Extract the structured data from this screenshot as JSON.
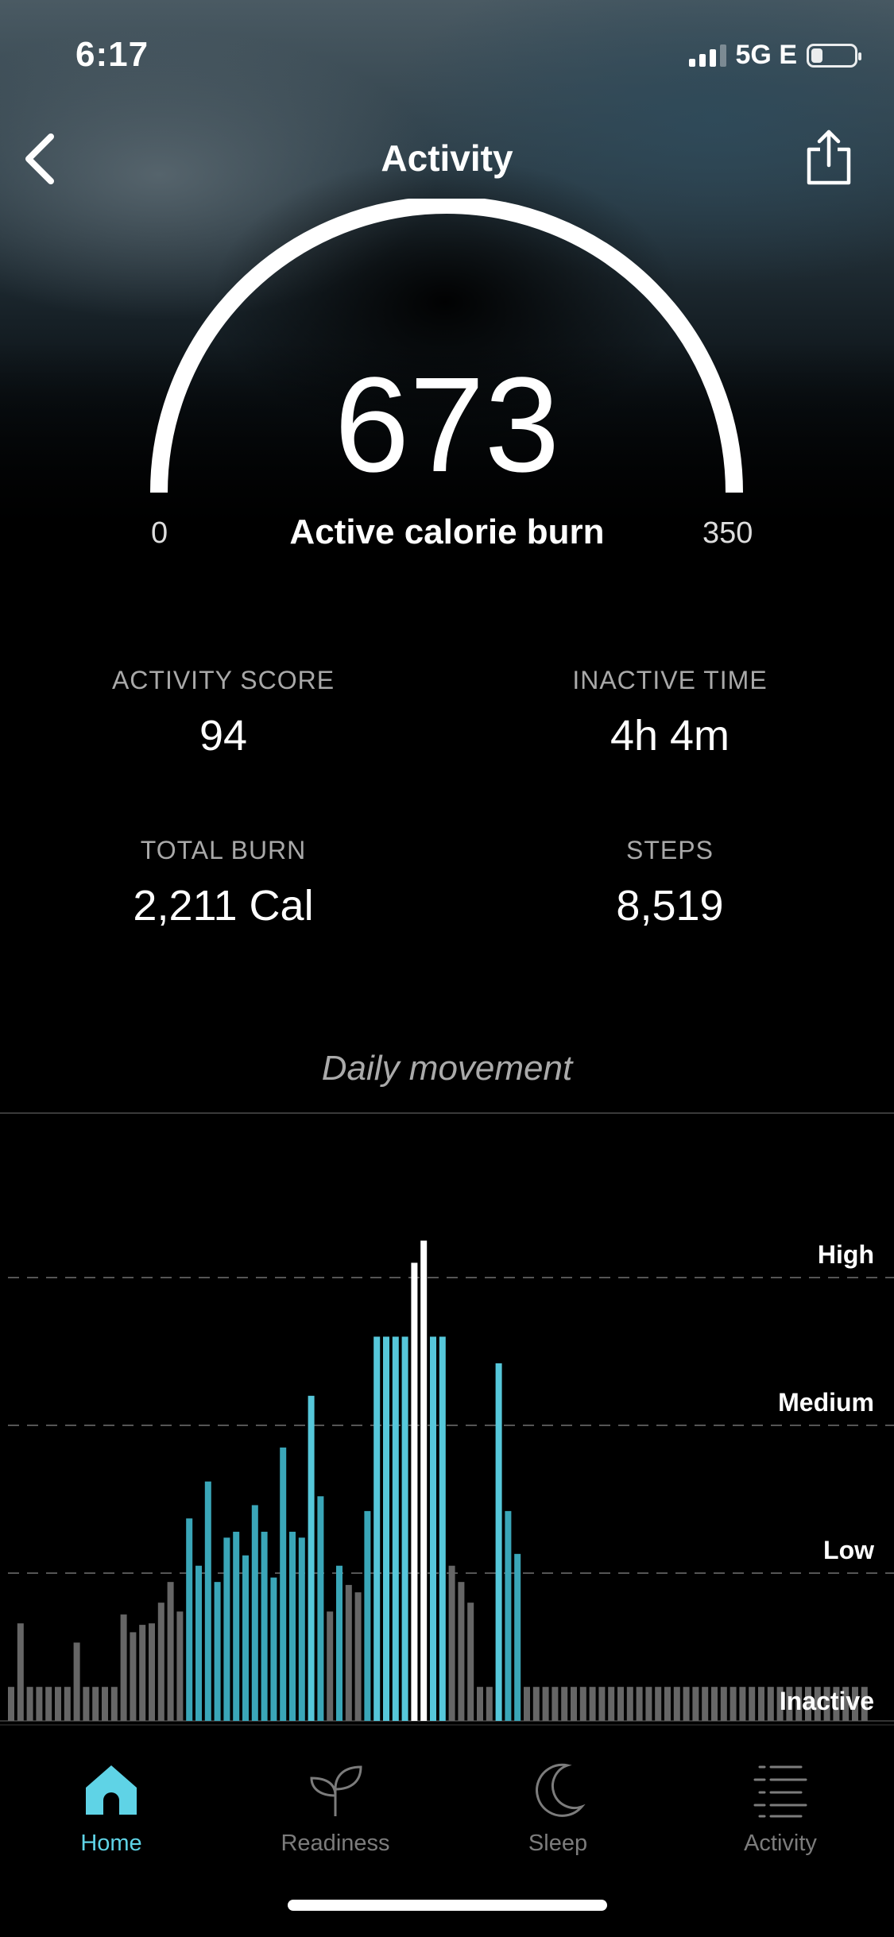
{
  "status": {
    "time": "6:17",
    "network": "5G E"
  },
  "header": {
    "title": "Activity"
  },
  "gauge": {
    "value": "673",
    "label": "Active calorie burn",
    "min": "0",
    "max": "350"
  },
  "stats": {
    "activity_score": {
      "label": "ACTIVITY SCORE",
      "value": "94"
    },
    "inactive_time": {
      "label": "INACTIVE TIME",
      "value": "4h 4m"
    },
    "total_burn": {
      "label": "TOTAL BURN",
      "value": "2,211 Cal"
    },
    "steps": {
      "label": "STEPS",
      "value": "8,519"
    }
  },
  "section": {
    "title": "Daily movement"
  },
  "chart_data": {
    "type": "bar",
    "title": "Daily movement",
    "levels": [
      "High",
      "Medium",
      "Low",
      "Inactive"
    ],
    "level_scale": {
      "Inactive": 0,
      "Low": 1,
      "Medium": 2,
      "High": 3
    },
    "ylim": [
      0,
      3.4
    ],
    "colors": {
      "inactive": "#666666",
      "active": "#56c7da",
      "active_dim": "#3aa6b8",
      "peak": "#ffffff",
      "bar_baseline": "#444444"
    },
    "bars": [
      {
        "v": 0.23,
        "c": "inactive"
      },
      {
        "v": 0.66,
        "c": "inactive"
      },
      {
        "v": 0.23,
        "c": "inactive"
      },
      {
        "v": 0.23,
        "c": "inactive"
      },
      {
        "v": 0.23,
        "c": "inactive"
      },
      {
        "v": 0.23,
        "c": "inactive"
      },
      {
        "v": 0.23,
        "c": "inactive"
      },
      {
        "v": 0.53,
        "c": "inactive"
      },
      {
        "v": 0.23,
        "c": "inactive"
      },
      {
        "v": 0.23,
        "c": "inactive"
      },
      {
        "v": 0.23,
        "c": "inactive"
      },
      {
        "v": 0.23,
        "c": "inactive"
      },
      {
        "v": 0.72,
        "c": "inactive"
      },
      {
        "v": 0.6,
        "c": "inactive"
      },
      {
        "v": 0.65,
        "c": "inactive"
      },
      {
        "v": 0.66,
        "c": "inactive"
      },
      {
        "v": 0.8,
        "c": "inactive"
      },
      {
        "v": 0.94,
        "c": "inactive"
      },
      {
        "v": 0.74,
        "c": "inactive"
      },
      {
        "v": 1.37,
        "c": "active_dim"
      },
      {
        "v": 1.05,
        "c": "active_dim"
      },
      {
        "v": 1.62,
        "c": "active_dim"
      },
      {
        "v": 0.94,
        "c": "active_dim"
      },
      {
        "v": 1.24,
        "c": "active_dim"
      },
      {
        "v": 1.28,
        "c": "active_dim"
      },
      {
        "v": 1.12,
        "c": "active_dim"
      },
      {
        "v": 1.46,
        "c": "active_dim"
      },
      {
        "v": 1.28,
        "c": "active_dim"
      },
      {
        "v": 0.97,
        "c": "active_dim"
      },
      {
        "v": 1.85,
        "c": "active_dim"
      },
      {
        "v": 1.28,
        "c": "active_dim"
      },
      {
        "v": 1.24,
        "c": "active_dim"
      },
      {
        "v": 2.2,
        "c": "active"
      },
      {
        "v": 1.52,
        "c": "active_dim"
      },
      {
        "v": 0.74,
        "c": "inactive"
      },
      {
        "v": 1.05,
        "c": "active_dim"
      },
      {
        "v": 0.92,
        "c": "inactive"
      },
      {
        "v": 0.87,
        "c": "inactive"
      },
      {
        "v": 1.42,
        "c": "active_dim"
      },
      {
        "v": 2.6,
        "c": "active"
      },
      {
        "v": 2.6,
        "c": "active"
      },
      {
        "v": 2.6,
        "c": "active"
      },
      {
        "v": 2.6,
        "c": "active"
      },
      {
        "v": 3.1,
        "c": "peak"
      },
      {
        "v": 3.25,
        "c": "peak"
      },
      {
        "v": 2.6,
        "c": "active"
      },
      {
        "v": 2.6,
        "c": "active"
      },
      {
        "v": 1.05,
        "c": "inactive"
      },
      {
        "v": 0.94,
        "c": "inactive"
      },
      {
        "v": 0.8,
        "c": "inactive"
      },
      {
        "v": 0.23,
        "c": "inactive"
      },
      {
        "v": 0.23,
        "c": "inactive"
      },
      {
        "v": 2.42,
        "c": "active"
      },
      {
        "v": 1.42,
        "c": "active_dim"
      },
      {
        "v": 1.13,
        "c": "active_dim"
      },
      {
        "v": 0.23,
        "c": "inactive"
      },
      {
        "v": 0.23,
        "c": "inactive"
      },
      {
        "v": 0.23,
        "c": "inactive"
      },
      {
        "v": 0.23,
        "c": "inactive"
      },
      {
        "v": 0.23,
        "c": "inactive"
      },
      {
        "v": 0.23,
        "c": "inactive"
      },
      {
        "v": 0.23,
        "c": "inactive"
      },
      {
        "v": 0.23,
        "c": "inactive"
      },
      {
        "v": 0.23,
        "c": "inactive"
      },
      {
        "v": 0.23,
        "c": "inactive"
      },
      {
        "v": 0.23,
        "c": "inactive"
      },
      {
        "v": 0.23,
        "c": "inactive"
      },
      {
        "v": 0.23,
        "c": "inactive"
      },
      {
        "v": 0.23,
        "c": "inactive"
      },
      {
        "v": 0.23,
        "c": "inactive"
      },
      {
        "v": 0.23,
        "c": "inactive"
      },
      {
        "v": 0.23,
        "c": "inactive"
      },
      {
        "v": 0.23,
        "c": "inactive"
      },
      {
        "v": 0.23,
        "c": "inactive"
      },
      {
        "v": 0.23,
        "c": "inactive"
      },
      {
        "v": 0.23,
        "c": "inactive"
      },
      {
        "v": 0.23,
        "c": "inactive"
      },
      {
        "v": 0.23,
        "c": "inactive"
      },
      {
        "v": 0.23,
        "c": "inactive"
      },
      {
        "v": 0.23,
        "c": "inactive"
      },
      {
        "v": 0.23,
        "c": "inactive"
      },
      {
        "v": 0.23,
        "c": "inactive"
      },
      {
        "v": 0.23,
        "c": "inactive"
      },
      {
        "v": 0.23,
        "c": "inactive"
      },
      {
        "v": 0.23,
        "c": "inactive"
      },
      {
        "v": 0.23,
        "c": "inactive"
      },
      {
        "v": 0.23,
        "c": "inactive"
      },
      {
        "v": 0.23,
        "c": "inactive"
      },
      {
        "v": 0.23,
        "c": "inactive"
      },
      {
        "v": 0.23,
        "c": "inactive"
      },
      {
        "v": 0.23,
        "c": "inactive"
      },
      {
        "v": 0.23,
        "c": "inactive"
      }
    ]
  },
  "tabbar": {
    "active_color": "#5fd3e6",
    "items": [
      {
        "label": "Home",
        "icon": "home-icon"
      },
      {
        "label": "Readiness",
        "icon": "sprout-icon"
      },
      {
        "label": "Sleep",
        "icon": "moon-icon"
      },
      {
        "label": "Activity",
        "icon": "activity-list-icon"
      }
    ]
  }
}
